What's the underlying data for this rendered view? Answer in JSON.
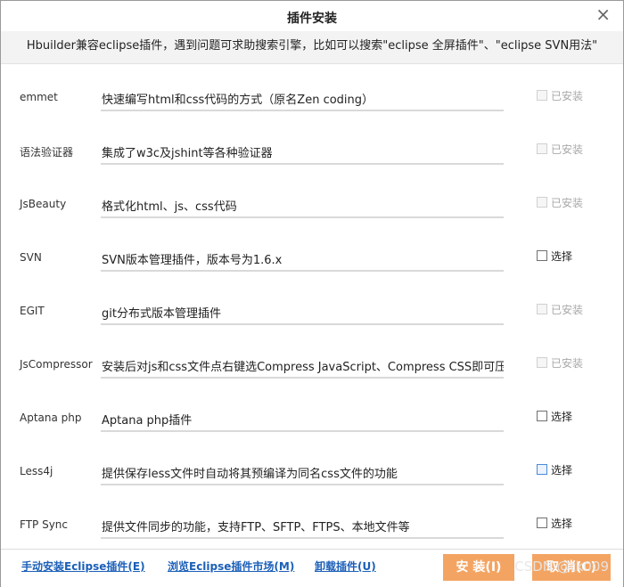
{
  "dialog": {
    "title": "插件安装",
    "close_glyph": "×",
    "subtitle": "Hbuilder兼容eclipse插件，遇到问题可求助搜索引擎，比如可以搜索\"eclipse 全屏插件\"、\"eclipse SVN用法\""
  },
  "plugins": [
    {
      "name": "emmet",
      "desc": "快速编写html和css代码的方式（原名Zen coding）",
      "status": "已安装",
      "state": "installed"
    },
    {
      "name": "语法验证器",
      "desc": "集成了w3c及jshint等各种验证器",
      "status": "已安装",
      "state": "installed"
    },
    {
      "name": "JsBeauty",
      "desc": "格式化html、js、css代码",
      "status": "已安装",
      "state": "installed"
    },
    {
      "name": "SVN",
      "desc": "SVN版本管理插件，版本号为1.6.x",
      "status": "选择",
      "state": "selectable"
    },
    {
      "name": "EGIT",
      "desc": "git分布式版本管理插件",
      "status": "已安装",
      "state": "installed"
    },
    {
      "name": "JsCompressor",
      "desc": "安装后对js和css文件点右键选Compress JavaScript、Compress CSS即可压缩",
      "status": "已安装",
      "state": "installed"
    },
    {
      "name": "Aptana php",
      "desc": "Aptana php插件",
      "status": "选择",
      "state": "selectable"
    },
    {
      "name": "Less4j",
      "desc": "提供保存less文件时自动将其预编译为同名css文件的功能",
      "status": "选择",
      "state": "focus"
    },
    {
      "name": "FTP Sync",
      "desc": "提供文件同步的功能，支持FTP、SFTP、FTPS、本地文件等",
      "status": "选择",
      "state": "selectable"
    }
  ],
  "footer": {
    "manual_install": "手动安装Eclipse插件(E)",
    "browse_market": "浏览Eclipse插件市场(M)",
    "uninstall": "卸载插件(U)",
    "install_btn": "安 装(I)",
    "cancel_btn": "取 消(C)"
  },
  "watermark": "CSDN @tk009",
  "colors": {
    "button": "#f4a462",
    "link": "#1b5fb8",
    "subtitle_bg": "#f3f3f3"
  }
}
